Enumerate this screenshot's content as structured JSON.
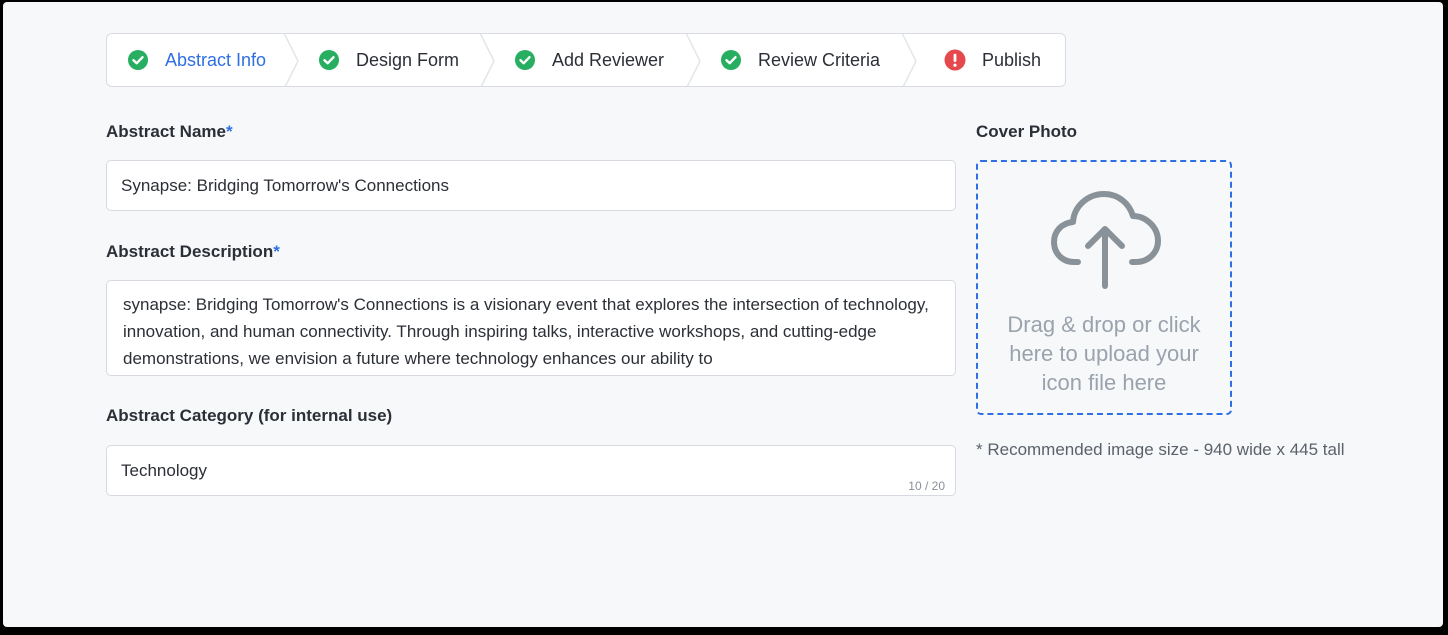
{
  "stepper": {
    "steps": [
      {
        "label": "Abstract Info",
        "status": "complete",
        "active": true
      },
      {
        "label": "Design Form",
        "status": "complete",
        "active": false
      },
      {
        "label": "Add Reviewer",
        "status": "complete",
        "active": false
      },
      {
        "label": "Review Criteria",
        "status": "complete",
        "active": false
      },
      {
        "label": "Publish",
        "status": "error",
        "active": false
      }
    ]
  },
  "form": {
    "name": {
      "label": "Abstract Name",
      "required_mark": "*",
      "value": "Synapse: Bridging Tomorrow's Connections"
    },
    "description": {
      "label": "Abstract Description",
      "required_mark": "*",
      "value": "synapse: Bridging Tomorrow's Connections is a visionary event that explores the intersection of technology, innovation, and human connectivity. Through inspiring talks, interactive workshops, and cutting-edge demonstrations, we envision a future where technology enhances our ability to"
    },
    "category": {
      "label": "Abstract Category (for internal use)",
      "value": "Technology",
      "counter": "10 / 20"
    }
  },
  "cover": {
    "label": "Cover Photo",
    "dropzone_text": "Drag & drop or click here to upload your icon file here",
    "hint": "* Recommended image size - 940 wide x 445 tall"
  },
  "colors": {
    "accent": "#2f6fe4",
    "success": "#27ae60",
    "error": "#e5484d"
  }
}
